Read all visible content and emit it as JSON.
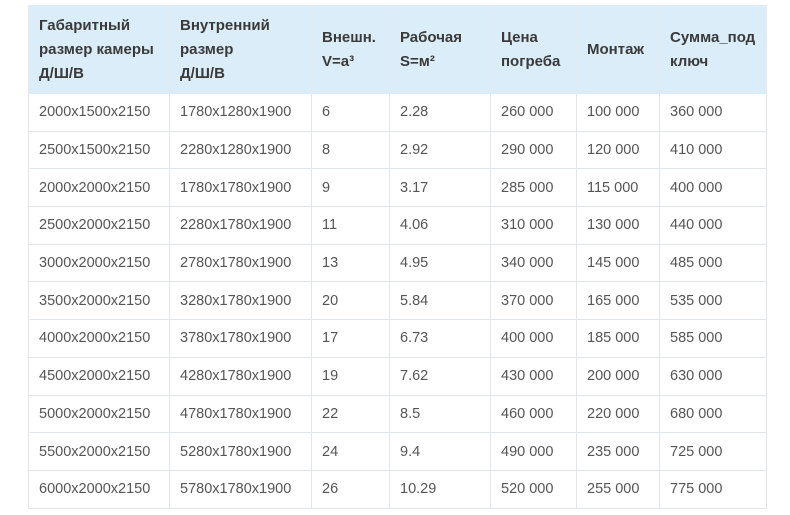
{
  "table": {
    "headers": [
      [
        "Габаритный",
        "размер камеры",
        "Д/Ш/В"
      ],
      [
        "Внутренний",
        "размер",
        "Д/Ш/В"
      ],
      [
        "Внешн.",
        "V=a³"
      ],
      [
        "Рабочая",
        "S=м²"
      ],
      [
        "Цена",
        "погреба"
      ],
      [
        "Монтаж"
      ],
      [
        "Сумма_под",
        "ключ"
      ]
    ],
    "rows": [
      [
        "2000x1500x2150",
        "1780x1280x1900",
        "6",
        "2.28",
        "260 000",
        "100 000",
        "360 000"
      ],
      [
        "2500x1500x2150",
        "2280x1280x1900",
        "8",
        "2.92",
        "290 000",
        "120 000",
        "410 000"
      ],
      [
        "2000x2000x2150",
        "1780x1780x1900",
        "9",
        "3.17",
        "285 000",
        "115 000",
        "400 000"
      ],
      [
        "2500x2000x2150",
        "2280x1780x1900",
        "11",
        "4.06",
        "310 000",
        "130 000",
        "440 000"
      ],
      [
        "3000x2000x2150",
        "2780x1780x1900",
        "13",
        "4.95",
        "340 000",
        "145 000",
        "485 000"
      ],
      [
        "3500x2000x2150",
        "3280x1780x1900",
        "20",
        "5.84",
        "370 000",
        "165 000",
        "535 000"
      ],
      [
        "4000x2000x2150",
        "3780x1780x1900",
        "17",
        "6.73",
        "400 000",
        "185 000",
        "585 000"
      ],
      [
        "4500x2000x2150",
        "4280x1780x1900",
        "19",
        "7.62",
        "430 000",
        "200 000",
        "630 000"
      ],
      [
        "5000x2000x2150",
        "4780x1780x1900",
        "22",
        "8.5",
        "460 000",
        "220 000",
        "680 000"
      ],
      [
        "5500x2000x2150",
        "5280x1780x1900",
        "24",
        "9.4",
        "490 000",
        "235 000",
        "725 000"
      ],
      [
        "6000x2000x2150",
        "5780x1780x1900",
        "26",
        "10.29",
        "520 000",
        "255 000",
        "775 000"
      ]
    ]
  },
  "colors": {
    "header_bg": "#daedf8",
    "header_text": "#3a3a3a",
    "cell_text": "#555555",
    "border": "#e3e6e9"
  }
}
